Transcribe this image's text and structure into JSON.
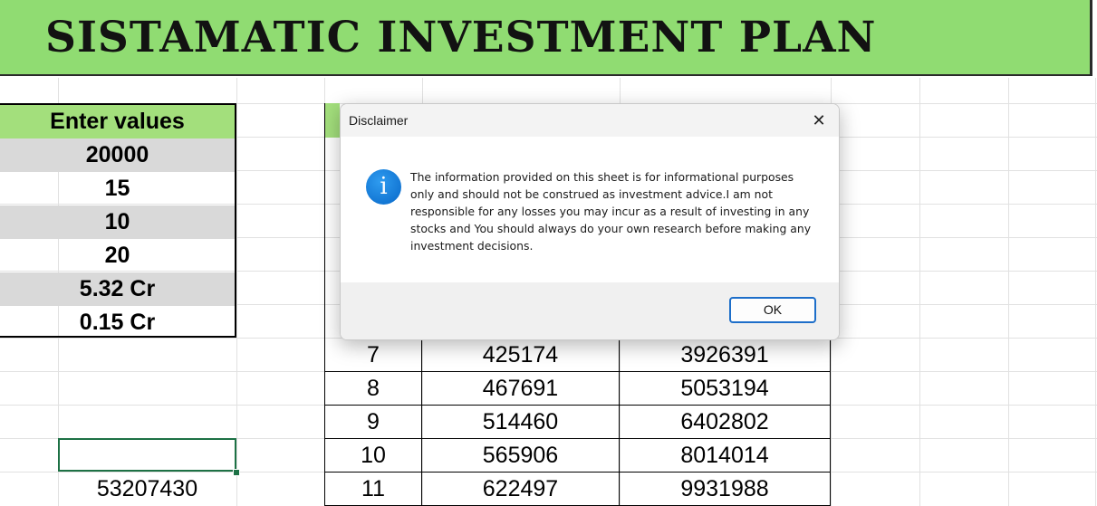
{
  "banner": {
    "title": "SISTAMATIC INVESTMENT PLAN"
  },
  "inputs": {
    "header": "Enter values",
    "values": [
      "20000",
      "15",
      "10",
      "20",
      "5.32 Cr",
      "0.15 Cr"
    ]
  },
  "selected_cell": {
    "value": ""
  },
  "total": {
    "value": "53207430"
  },
  "sip_table": {
    "rows": [
      {
        "year": "7",
        "invested": "425174",
        "value": "3926391"
      },
      {
        "year": "8",
        "invested": "467691",
        "value": "5053194"
      },
      {
        "year": "9",
        "invested": "514460",
        "value": "6402802"
      },
      {
        "year": "10",
        "invested": "565906",
        "value": "8014014"
      },
      {
        "year": "11",
        "invested": "622497",
        "value": "9931988"
      }
    ]
  },
  "dialog": {
    "title": "Disclaimer",
    "close_glyph": "✕",
    "icon": "info-icon",
    "icon_glyph": "i",
    "message": "The information provided on this sheet is for informational purposes only and should not be construed as investment advice.I am not responsible for any losses you may incur as a result of investing in any stocks and You should always do your own research before making any investment decisions.",
    "ok_label": "OK"
  },
  "colors": {
    "banner": "#90dc72",
    "header_green": "#a3df7c",
    "alt_row": "#d9d9d9",
    "selection": "#1d7145",
    "dialog_accent": "#1d6ec9"
  }
}
